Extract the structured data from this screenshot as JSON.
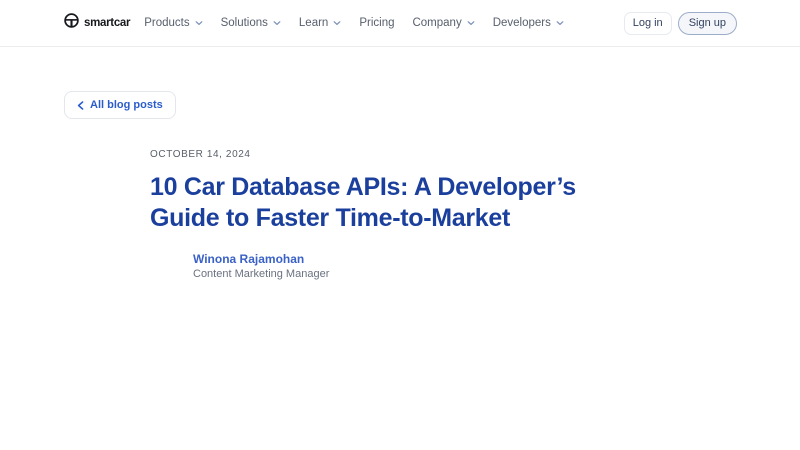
{
  "nav": {
    "logo_text": "smartcar",
    "items": [
      {
        "label": "Products"
      },
      {
        "label": "Solutions"
      },
      {
        "label": "Learn"
      },
      {
        "label": "Pricing"
      },
      {
        "label": "Company"
      },
      {
        "label": "Developers"
      }
    ],
    "login_label": "Log in",
    "signup_label": "Sign up"
  },
  "article": {
    "back_link": "All blog posts",
    "date": "OCTOBER 14, 2024",
    "title": "10 Car Database APIs: A Developer’s Guide to Faster Time-to-Market",
    "author": {
      "name": "Winona Rajamohan",
      "role": "Content Marketing Manager"
    }
  },
  "colors": {
    "title_blue": "#1a3f9c",
    "link_blue": "#2b5ccc",
    "nav_text": "#575f6c",
    "button_text": "#33425f",
    "nav_border": "#ececef"
  }
}
